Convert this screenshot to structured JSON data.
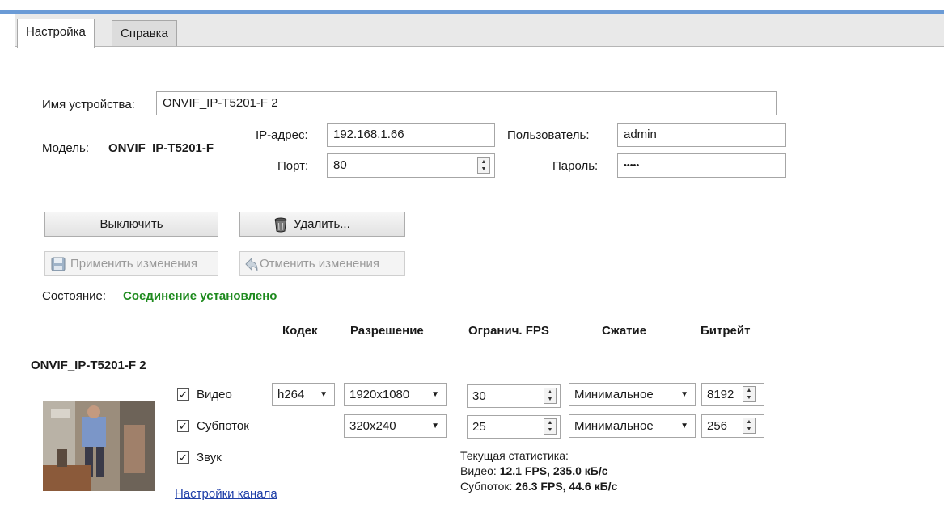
{
  "tabs": [
    {
      "label": "Настройка",
      "active": true
    },
    {
      "label": "Справка",
      "active": false
    }
  ],
  "device": {
    "name_label": "Имя устройства:",
    "name_value": "ONVIF_IP-T5201-F 2",
    "model_label": "Модель:",
    "model_value": "ONVIF_IP-T5201-F",
    "ip_label": "IP-адрес:",
    "ip_value": "192.168.1.66",
    "port_label": "Порт:",
    "port_value": "80",
    "user_label": "Пользователь:",
    "user_value": "admin",
    "password_label": "Пароль:",
    "password_value": "•••••"
  },
  "buttons": {
    "disable": "Выключить",
    "delete": "Удалить...",
    "apply": "Применить изменения",
    "cancel": "Отменить изменения"
  },
  "status": {
    "label": "Состояние:",
    "value": "Соединение установлено",
    "color": "#1e8a1e"
  },
  "stream_table": {
    "headers": [
      "Кодек",
      "Разрешение",
      "Огранич. FPS",
      "Сжатие",
      "Битрейт"
    ],
    "camera_name": "ONVIF_IP-T5201-F 2",
    "rows": [
      {
        "label": "Видео",
        "checked": true,
        "codec": "h264",
        "resolution": "1920x1080",
        "fps": "30",
        "compression": "Минимальное",
        "bitrate": "8192"
      },
      {
        "label": "Субпоток",
        "checked": true,
        "codec": "",
        "resolution": "320x240",
        "fps": "25",
        "compression": "Минимальное",
        "bitrate": "256"
      },
      {
        "label": "Звук",
        "checked": true
      }
    ],
    "channel_settings_link": "Настройки канала"
  },
  "stats": {
    "title": "Текущая статистика:",
    "video_label": "Видео:",
    "video_value": "12.1 FPS, 235.0 кБ/с",
    "sub_label": "Субпоток:",
    "sub_value": "26.3 FPS, 44.6 кБ/с"
  },
  "icons": {
    "delete": "trash-bin-icon",
    "apply": "save-disk-icon",
    "cancel": "undo-arrow-icon"
  },
  "colors": {
    "accent_bar": "#6b9bd6",
    "link": "#1f3fa8"
  }
}
